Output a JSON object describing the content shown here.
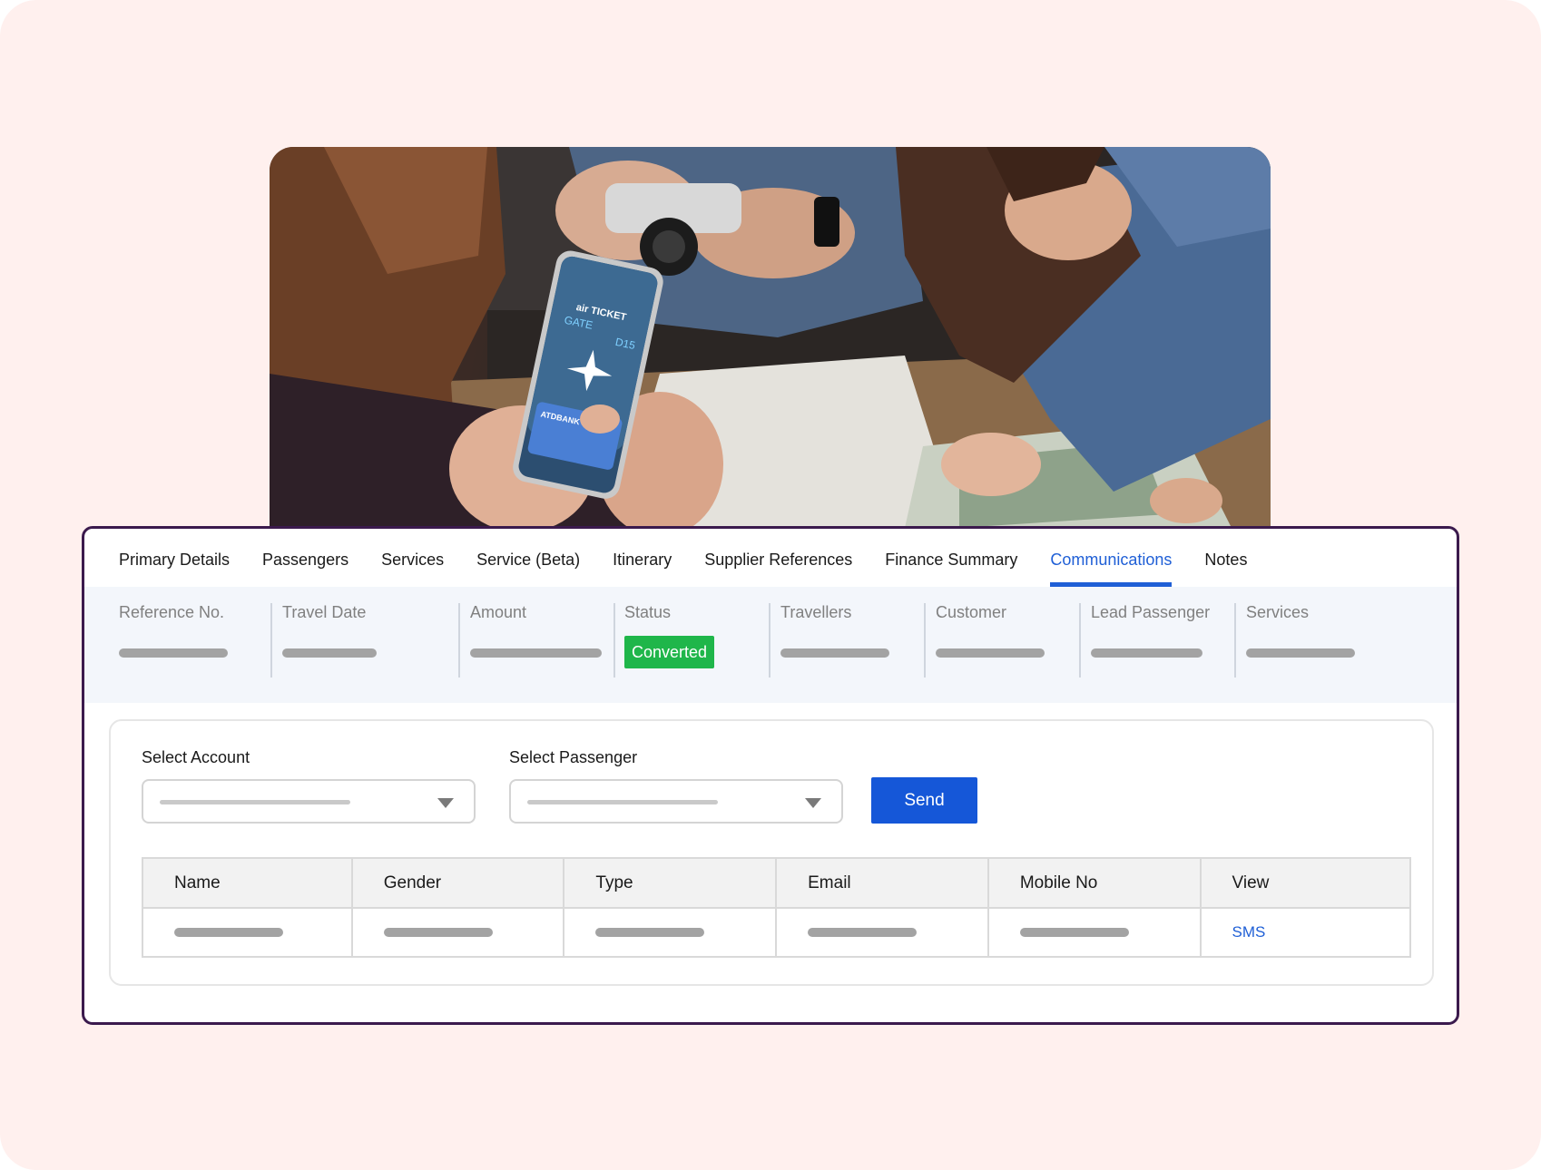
{
  "tabs": [
    {
      "label": "Primary Details",
      "active": false
    },
    {
      "label": "Passengers",
      "active": false
    },
    {
      "label": "Services",
      "active": false
    },
    {
      "label": "Service (Beta)",
      "active": false
    },
    {
      "label": "Itinerary",
      "active": false
    },
    {
      "label": "Supplier References",
      "active": false
    },
    {
      "label": "Finance Summary",
      "active": false
    },
    {
      "label": "Communications",
      "active": true
    },
    {
      "label": "Notes",
      "active": false
    }
  ],
  "summary": {
    "reference_no": "Reference No.",
    "travel_date": "Travel Date",
    "amount": "Amount",
    "status": "Status",
    "status_value": "Converted",
    "travellers": "Travellers",
    "customer": "Customer",
    "lead_passenger": "Lead Passenger",
    "services": "Services"
  },
  "form": {
    "select_account_label": "Select Account",
    "select_passenger_label": "Select Passenger",
    "send_label": "Send"
  },
  "table": {
    "headers": [
      "Name",
      "Gender",
      "Type",
      "Email",
      "Mobile No",
      "View"
    ],
    "row_view_link": "SMS"
  },
  "photo": {
    "ticket_title": "air TICKET",
    "gate_label": "GATE",
    "gate_value": "D15",
    "card_brand": "ATDBANK"
  },
  "colors": {
    "background": "#fff0ee",
    "panel_border": "#3b1a4d",
    "accent": "#1f5fd6",
    "status_green": "#1fb64a",
    "send_button": "#1557d8"
  }
}
